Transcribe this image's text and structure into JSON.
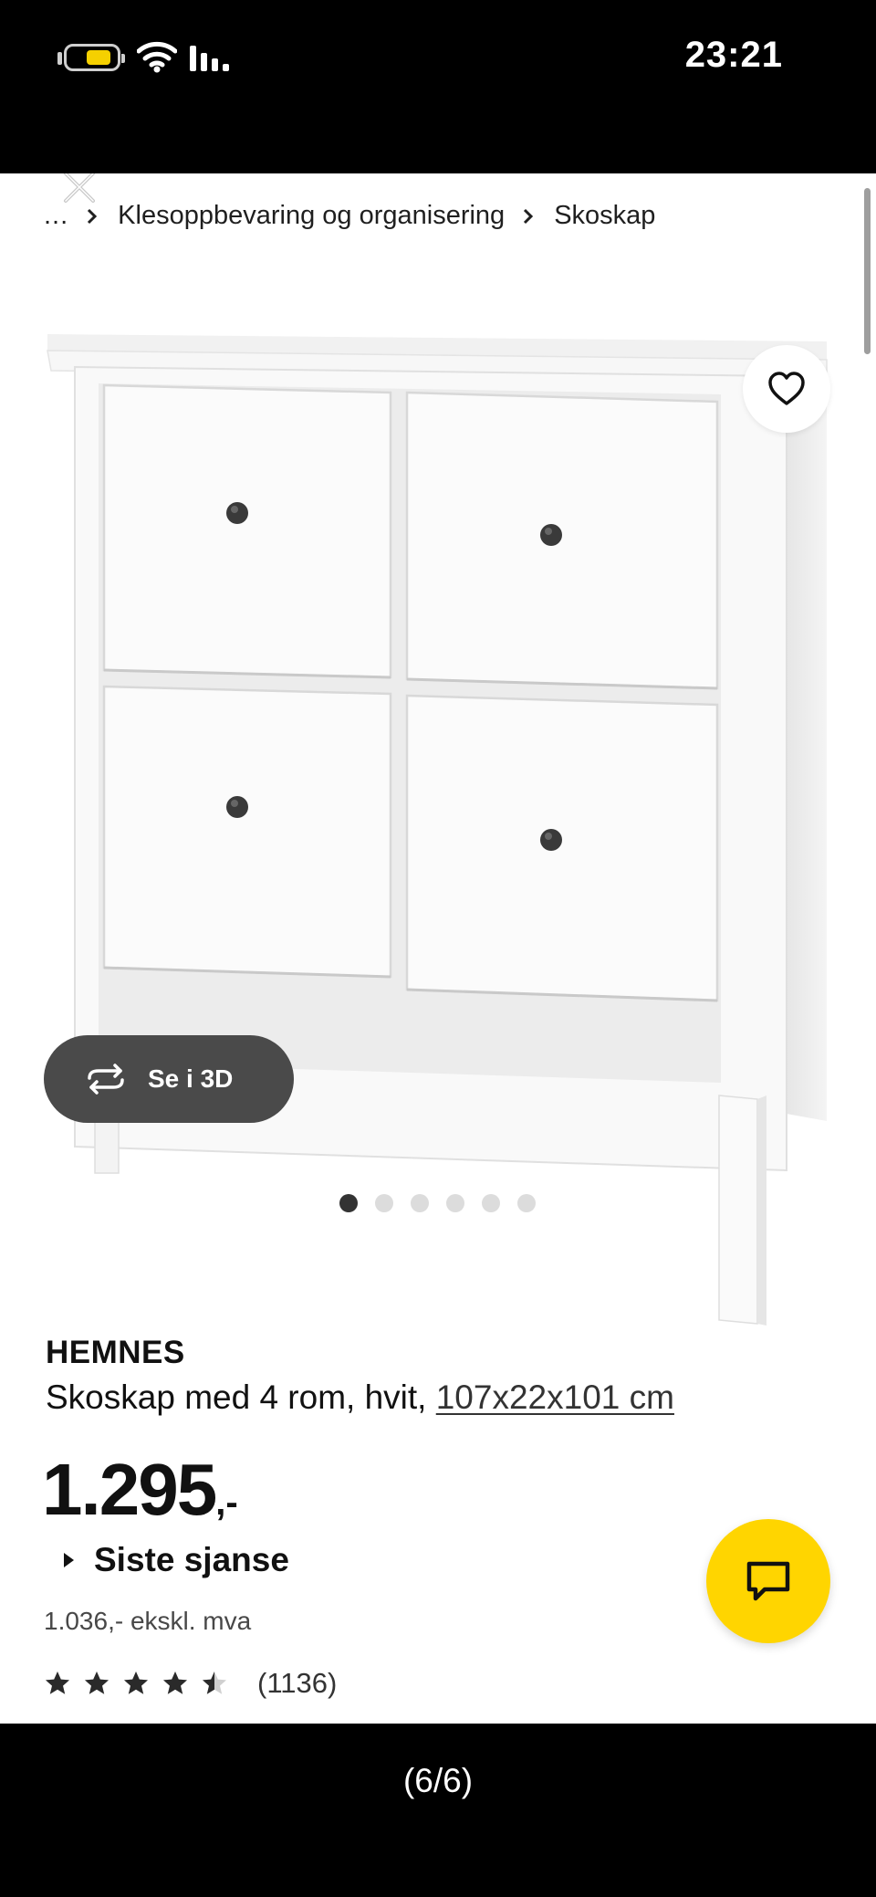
{
  "status_bar": {
    "time": "23:21"
  },
  "breadcrumb": {
    "ellipsis": "...",
    "items": [
      "Klesoppbevaring og organisering",
      "Skoskap"
    ]
  },
  "gallery": {
    "view_3d_label": "Se i 3D",
    "image_count": 6,
    "active_index": 0
  },
  "product": {
    "name": "HEMNES",
    "description": "Skoskap med 4 rom, hvit,",
    "dimensions": "107x22x101 cm",
    "price_main": "1.295",
    "price_suffix": ",-",
    "badge": "Siste sjanse",
    "price_ex_vat": "1.036,- ekskl. mva",
    "rating_value": 4.5,
    "rating_count": "(1136)"
  },
  "footer": {
    "page_counter": "(6/6)"
  },
  "colors": {
    "accent_yellow": "#ffd500",
    "text": "#111111",
    "button_dark": "#4a4a4a"
  },
  "icons": [
    "battery-icon",
    "wifi-icon",
    "signal-icon",
    "close-icon",
    "chevron-right-icon",
    "heart-icon",
    "rotate-3d-icon",
    "chat-icon",
    "star-icon",
    "half-star-icon"
  ]
}
